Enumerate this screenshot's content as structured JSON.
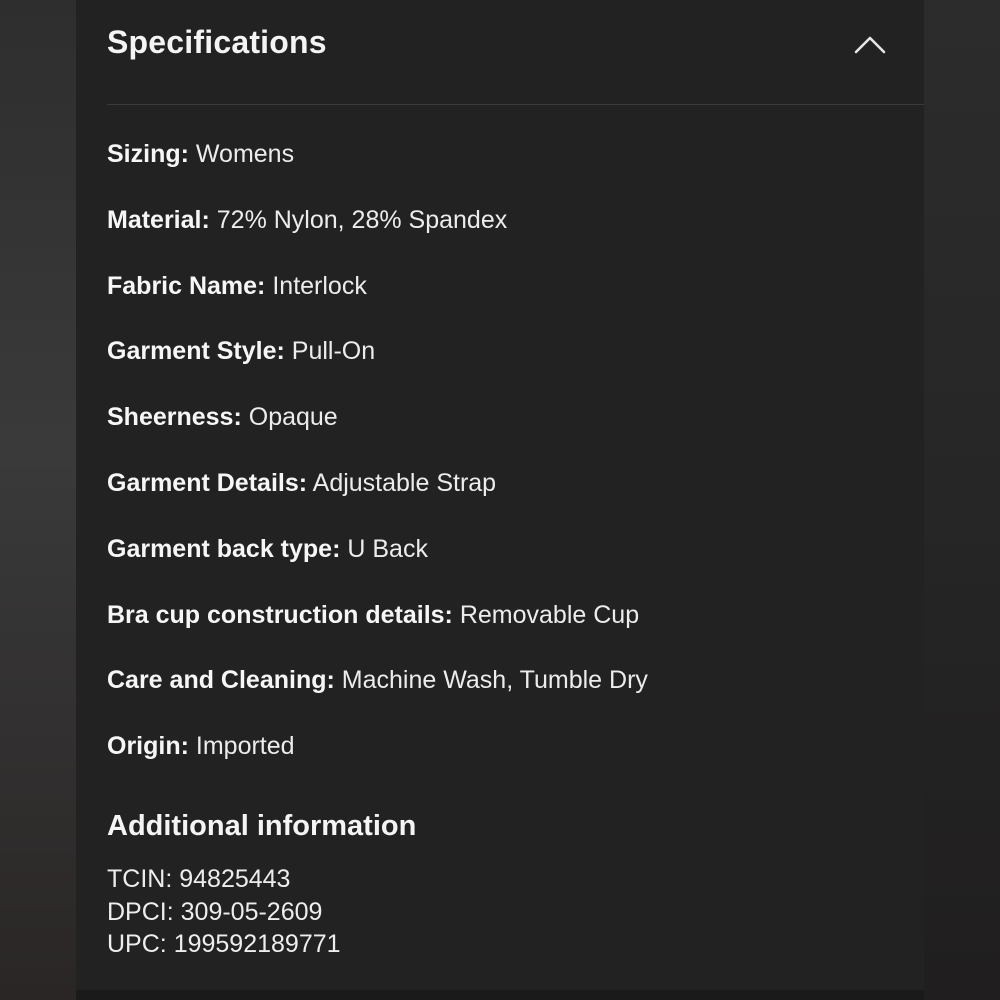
{
  "specifications": {
    "title": "Specifications",
    "toggle_icon": "chevron-up-icon",
    "items": [
      {
        "label": "Sizing:",
        "value": "Womens"
      },
      {
        "label": "Material:",
        "value": "72% Nylon, 28% Spandex"
      },
      {
        "label": "Fabric Name:",
        "value": "Interlock"
      },
      {
        "label": "Garment Style:",
        "value": "Pull-On"
      },
      {
        "label": "Sheerness:",
        "value": "Opaque"
      },
      {
        "label": "Garment Details:",
        "value": "Adjustable Strap"
      },
      {
        "label": "Garment back type:",
        "value": "U Back"
      },
      {
        "label": "Bra cup construction details:",
        "value": "Removable Cup"
      },
      {
        "label": "Care and Cleaning:",
        "value": "Machine Wash, Tumble Dry"
      },
      {
        "label": "Origin:",
        "value": "Imported"
      }
    ]
  },
  "additional": {
    "title": "Additional information",
    "items": [
      {
        "label": "TCIN:",
        "value": "94825443"
      },
      {
        "label": "DPCI:",
        "value": "309-05-2609"
      },
      {
        "label": "UPC:",
        "value": "199592189771"
      }
    ]
  }
}
